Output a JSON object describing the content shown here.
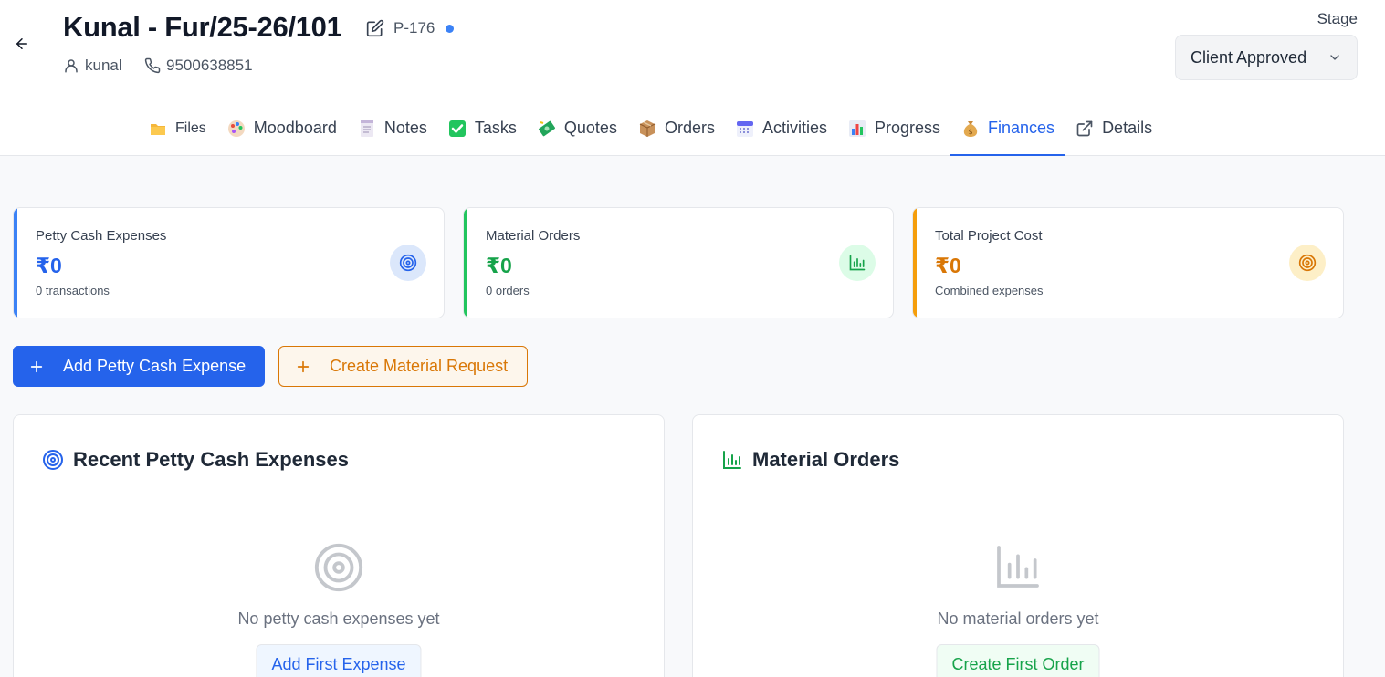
{
  "header": {
    "title": "Kunal - Fur/25-26/101",
    "project_code": "P-176",
    "client_name": "kunal",
    "phone": "9500638851"
  },
  "stage": {
    "label": "Stage",
    "value": "Client Approved"
  },
  "tabs": [
    {
      "label": "Files",
      "icon": "folder-icon"
    },
    {
      "label": "Moodboard",
      "icon": "palette-icon"
    },
    {
      "label": "Notes",
      "icon": "notepad-icon"
    },
    {
      "label": "Tasks",
      "icon": "check-box-icon"
    },
    {
      "label": "Quotes",
      "icon": "money-icon"
    },
    {
      "label": "Orders",
      "icon": "package-icon"
    },
    {
      "label": "Activities",
      "icon": "calendar-icon"
    },
    {
      "label": "Progress",
      "icon": "bar-chart-icon"
    },
    {
      "label": "Finances",
      "icon": "money-bag-icon",
      "active": true
    },
    {
      "label": "Details",
      "icon": "external-link-icon"
    }
  ],
  "summary_cards": {
    "petty_cash": {
      "label": "Petty Cash Expenses",
      "value": "₹0",
      "sub": "0 transactions",
      "color": "#2563eb",
      "icon": "target-icon"
    },
    "material_orders": {
      "label": "Material Orders",
      "value": "₹0",
      "sub": "0 orders",
      "color": "#16a34a",
      "icon": "bar-chart-icon"
    },
    "total_cost": {
      "label": "Total Project Cost",
      "value": "₹0",
      "sub": "Combined expenses",
      "color": "#d97706",
      "icon": "target-icon"
    }
  },
  "actions": {
    "add_petty_cash": "Add Petty Cash Expense",
    "create_material_request": "Create Material Request"
  },
  "panels": {
    "petty_cash": {
      "title": "Recent Petty Cash Expenses",
      "empty_text": "No petty cash expenses yet",
      "button": "Add First Expense"
    },
    "material_orders": {
      "title": "Material Orders",
      "empty_text": "No material orders yet",
      "button": "Create First Order"
    }
  }
}
